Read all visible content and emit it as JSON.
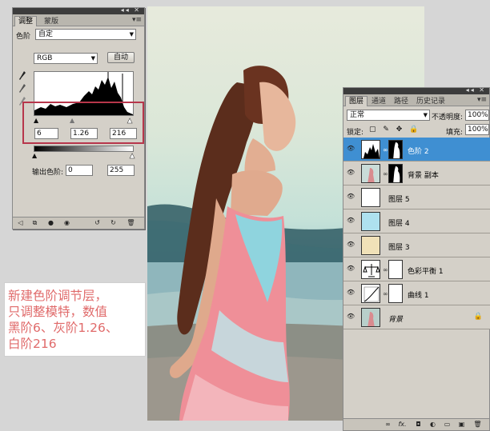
{
  "adjustments_panel": {
    "tabs": [
      "调整",
      "蒙版"
    ],
    "preset_label": "色阶",
    "preset_value": "自定",
    "channel_value": "RGB",
    "auto_button": "自动",
    "input_black": "6",
    "input_gray": "1.26",
    "input_white": "216",
    "output_label": "输出色阶:",
    "output_black": "0",
    "output_white": "255"
  },
  "annotation": {
    "lines": [
      "新建色阶调节层，",
      "只调整模特，数值",
      "黑阶6、灰阶1.26、",
      "白阶216"
    ]
  },
  "layers_panel": {
    "tabs": [
      "图层",
      "通道",
      "路径",
      "历史记录"
    ],
    "blend_mode": "正常",
    "opacity_label": "不透明度:",
    "opacity_value": "100%",
    "lock_label": "锁定:",
    "fill_label": "填充:",
    "fill_value": "100%",
    "layers": [
      {
        "name": "色阶 2",
        "selected": true
      },
      {
        "name": "背景 副本",
        "selected": false
      },
      {
        "name": "图层 5",
        "selected": false
      },
      {
        "name": "图层 4",
        "selected": false
      },
      {
        "name": "图层 3",
        "selected": false
      },
      {
        "name": "色彩平衡 1",
        "selected": false
      },
      {
        "name": "曲线 1",
        "selected": false
      },
      {
        "name": "背景",
        "selected": false
      }
    ],
    "footer_icons": [
      "link-icon",
      "fx-icon",
      "mask-icon",
      "adjustment-icon",
      "group-icon",
      "new-layer-icon",
      "trash-icon"
    ]
  },
  "colors": {
    "highlight_border": "#b7364b",
    "annotation_text": "#e06a6a",
    "selected_layer": "#3f8fd2"
  }
}
